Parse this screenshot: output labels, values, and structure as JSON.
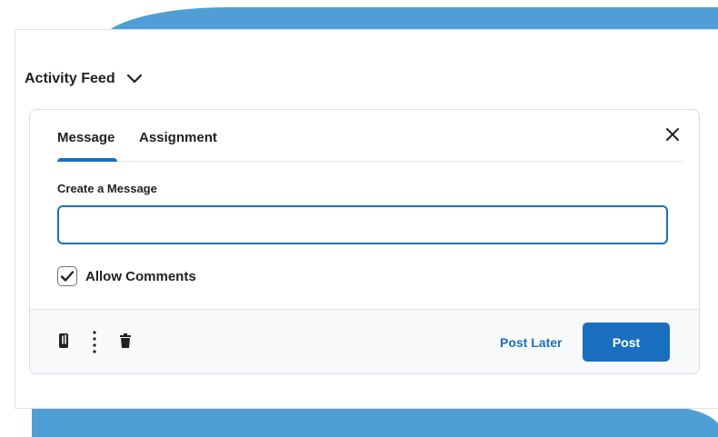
{
  "feed": {
    "title": "Activity Feed",
    "dropdown_icon": "chevron-down-icon"
  },
  "tabs": [
    {
      "label": "Message",
      "selected": true
    },
    {
      "label": "Assignment",
      "selected": false
    }
  ],
  "close_icon": "close-icon",
  "form": {
    "field_label": "Create a Message",
    "message_value": "",
    "allow_comments_label": "Allow Comments",
    "allow_comments_checked": true
  },
  "toolbar": {
    "attach_icon": "paperclip-icon",
    "more_icon": "more-vertical-icon",
    "delete_icon": "trash-icon",
    "post_later_label": "Post Later",
    "post_label": "Post"
  },
  "colors": {
    "accent": "#1b6fbf",
    "background_shape": "#4f9fd6"
  }
}
